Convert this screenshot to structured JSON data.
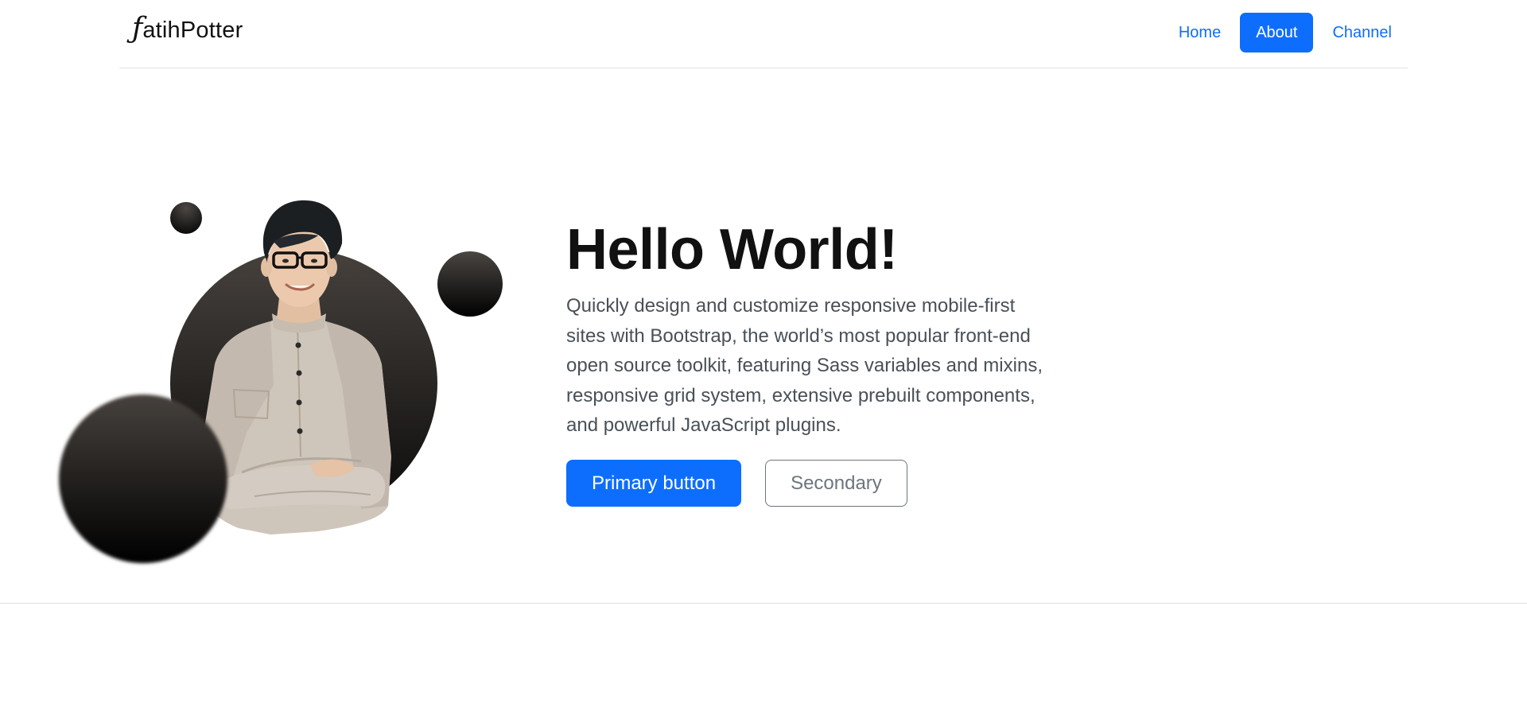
{
  "brand": {
    "letter": "ƒ",
    "name": "atihPotter"
  },
  "nav": {
    "items": [
      {
        "label": "Home",
        "active": false
      },
      {
        "label": "About",
        "active": true
      },
      {
        "label": "Channel",
        "active": false
      }
    ]
  },
  "hero": {
    "title": "Hello World!",
    "lead": "Quickly design and customize responsive mobile-first sites with Bootstrap, the world’s most popular front-end open source toolkit, featuring Sass variables and mixins, responsive grid system, extensive prebuilt components, and powerful JavaScript plugins.",
    "primary_button": "Primary button",
    "secondary_button": "Secondary"
  },
  "colors": {
    "accent": "#0d6efd",
    "muted": "#6c757d",
    "bubble_dark": "#1a1817"
  }
}
